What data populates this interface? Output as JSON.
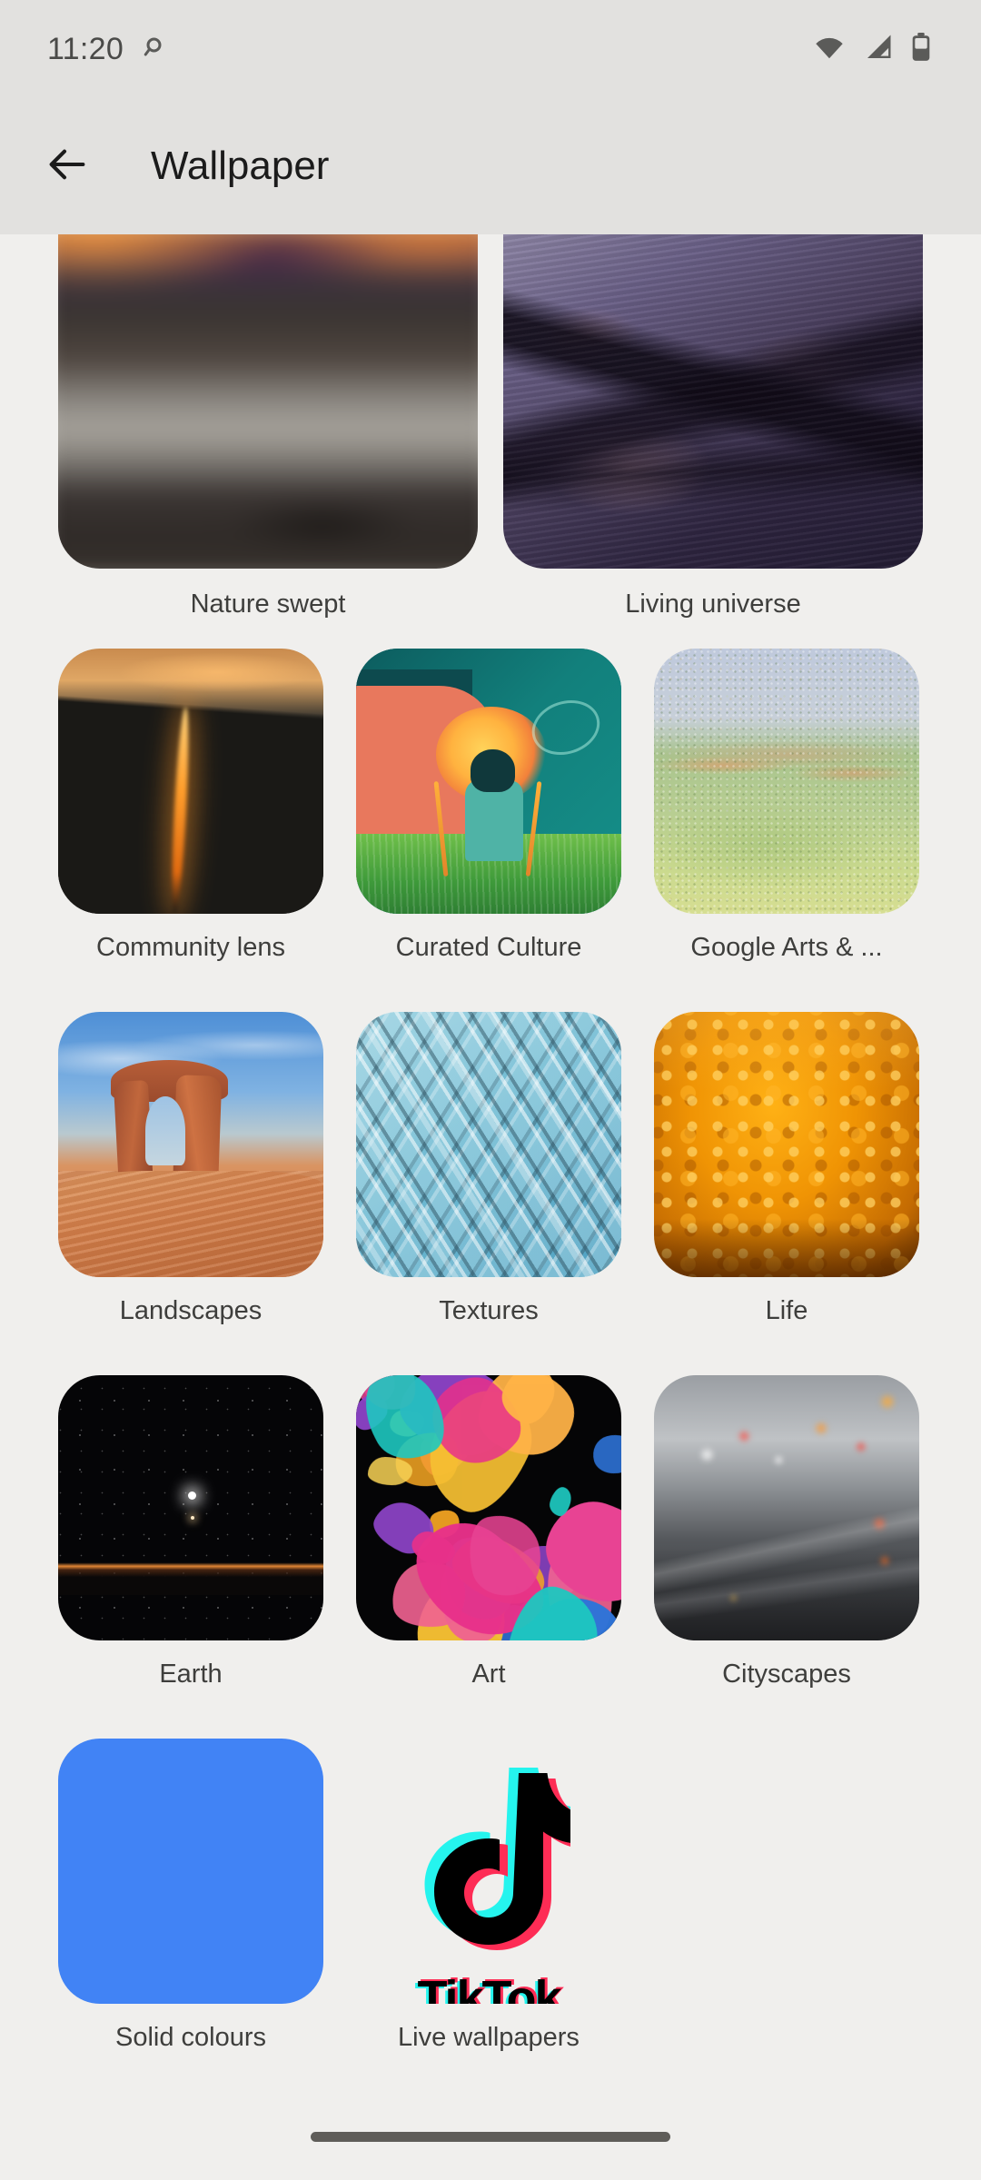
{
  "status_bar": {
    "time": "11:20",
    "icons": [
      "camera-privacy-icon",
      "wifi-icon",
      "cellular-signal-icon",
      "battery-icon"
    ]
  },
  "app_bar": {
    "back_icon": "back-arrow-icon",
    "title": "Wallpaper"
  },
  "theme": {
    "page_background": "#F0EFED",
    "app_bar_background": "#E2E1DF",
    "label_color": "#3E3E3C",
    "title_color": "#1B1B1B",
    "solid_colour_swatch": "#4183F5",
    "tiktok_cyan": "#25F4EE",
    "tiktok_pink": "#FE2C55",
    "nav_pill_color": "#5F5D59"
  },
  "featured_row": [
    {
      "label": "Nature swept",
      "art": "nature-swept-thumbnail"
    },
    {
      "label": "Living universe",
      "art": "living-universe-thumbnail"
    }
  ],
  "categories": [
    {
      "label": "Community lens",
      "art": "community-lens-thumbnail"
    },
    {
      "label": "Curated Culture",
      "art": "curated-culture-thumbnail"
    },
    {
      "label": "Google Arts & ...",
      "art": "google-arts-thumbnail"
    },
    {
      "label": "Landscapes",
      "art": "landscapes-thumbnail"
    },
    {
      "label": "Textures",
      "art": "textures-thumbnail"
    },
    {
      "label": "Life",
      "art": "life-thumbnail"
    },
    {
      "label": "Earth",
      "art": "earth-thumbnail"
    },
    {
      "label": "Art",
      "art": "art-thumbnail"
    },
    {
      "label": "Cityscapes",
      "art": "cityscapes-thumbnail"
    },
    {
      "label": "Solid colours",
      "art": "solid-colours-thumbnail"
    },
    {
      "label": "Live wallpapers",
      "art": "tiktok-live-wallpaper-thumbnail"
    }
  ],
  "tiktok": {
    "wordmark": "TikTok"
  },
  "navigation": {
    "gesture_pill": "home-gesture-pill"
  }
}
